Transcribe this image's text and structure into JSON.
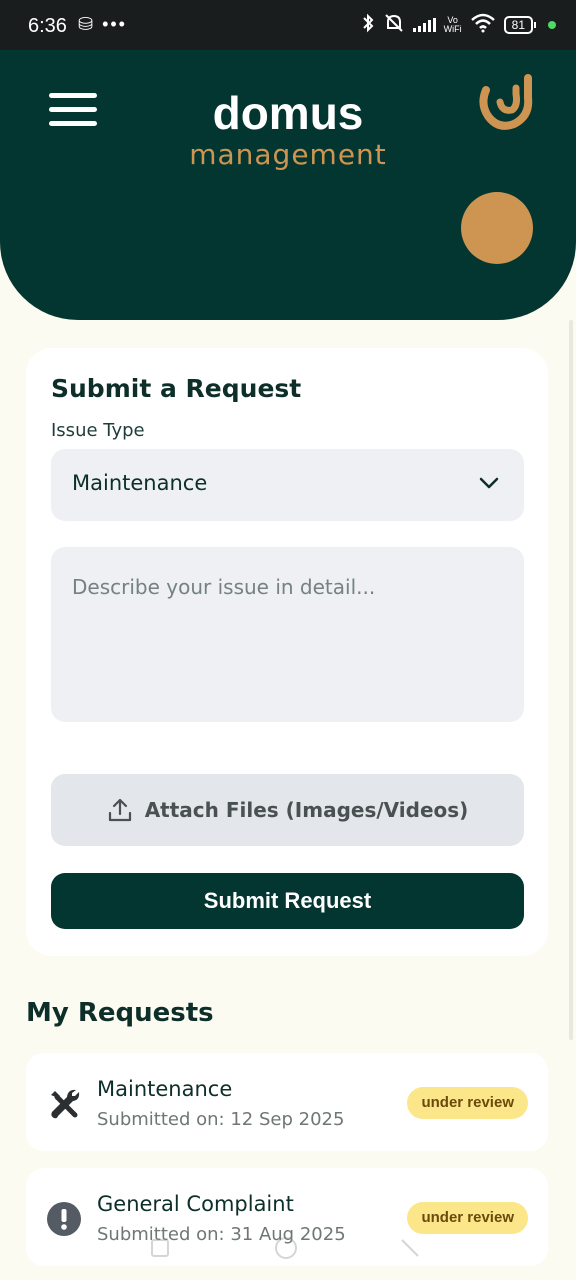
{
  "status_bar": {
    "time": "6:36",
    "left_icons": "⛁ •••",
    "vowifi_top": "Vo",
    "vowifi_bottom": "WiFi",
    "battery": "81"
  },
  "header": {
    "brand_title": "domus",
    "brand_subtitle": "management",
    "accent_color": "#cd9551",
    "bg_color": "#033630"
  },
  "form": {
    "title": "Submit a Request",
    "issue_type_label": "Issue Type",
    "issue_type_value": "Maintenance",
    "description_placeholder": "Describe your issue in detail...",
    "attach_label": "Attach Files (Images/Videos)",
    "submit_label": "Submit Request"
  },
  "requests": {
    "title": "My Requests",
    "items": [
      {
        "title": "Maintenance",
        "date": "Submitted on: 12 Sep 2025",
        "status": "under review",
        "icon": "tools-icon"
      },
      {
        "title": "General Complaint",
        "date": "Submitted on: 31 Aug 2025",
        "status": "under review",
        "icon": "exclamation-icon"
      }
    ]
  }
}
